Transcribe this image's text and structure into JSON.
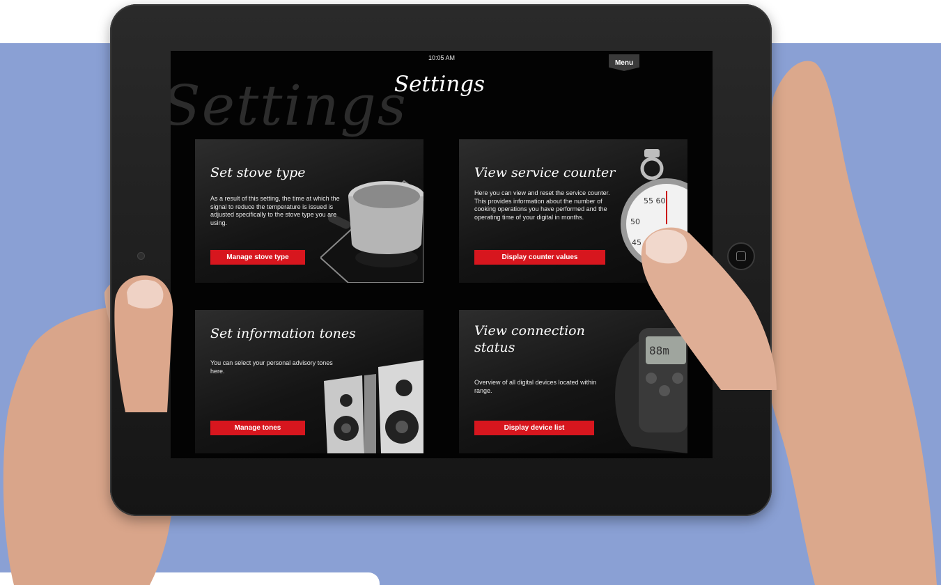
{
  "screen": {
    "status_time": "10:05 AM",
    "menu_label": "Menu",
    "title": "Settings",
    "watermark": "Settings"
  },
  "cards": [
    {
      "title": "Set stove type",
      "description": "As a result of this setting, the time at which the signal to reduce the temperature is issued is adjusted specifically to the stove type you are using.",
      "button": "Manage stove type",
      "image": "stove-pot-icon"
    },
    {
      "title": "View service counter",
      "description": "Here you can view and reset the service counter. This provides information about the number of cooking operations you have performed and the operating time of your digital in months.",
      "button": "Display counter values",
      "image": "stopwatch-icon"
    },
    {
      "title": "Set information tones",
      "description": "You can select your personal advisory tones here.",
      "button": "Manage tones",
      "image": "speakers-icon"
    },
    {
      "title": "View connection status",
      "description": "Overview of all digital devices located within range.",
      "button": "Display device list",
      "image": "device-icon"
    }
  ],
  "colors": {
    "background": "#8aa0d4",
    "accent": "#d7161e",
    "screen": "#030303"
  }
}
